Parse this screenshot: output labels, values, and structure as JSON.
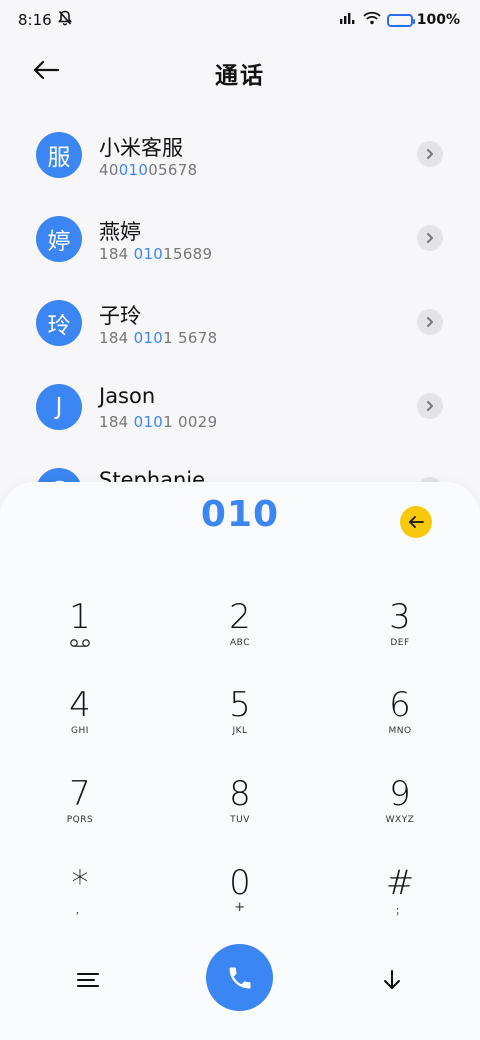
{
  "status_bar": {
    "time": "8:16",
    "battery_label": "100%",
    "battery_level": 1.0,
    "icons": [
      "bell-off-icon",
      "signal-icon",
      "wifi-icon",
      "battery-icon"
    ]
  },
  "header": {
    "title": "通话",
    "back_icon": "arrow-left-icon"
  },
  "contacts": [
    {
      "avatar": "服",
      "name": "小米客服",
      "num_pre": "40",
      "num_hl": "010",
      "num_post": "05678"
    },
    {
      "avatar": "婷",
      "name": "燕婷",
      "num_pre": "184 ",
      "num_hl": "010",
      "num_post": "15689"
    },
    {
      "avatar": "玲",
      "name": "子玲",
      "num_pre": "184 ",
      "num_hl": "010",
      "num_post": "1 5678"
    },
    {
      "avatar": "J",
      "name": "Jason",
      "num_pre": "184 ",
      "num_hl": "010",
      "num_post": "1 0029"
    },
    {
      "avatar": "S",
      "name": "Stephanie",
      "num_pre": "",
      "num_hl": "",
      "num_post": ""
    }
  ],
  "dialpad": {
    "input": "010",
    "delete_icon": "backspace-arrow-icon",
    "keys": [
      {
        "digit": "1",
        "letters": "voicemail-icon"
      },
      {
        "digit": "2",
        "letters": "ABC"
      },
      {
        "digit": "3",
        "letters": "DEF"
      },
      {
        "digit": "4",
        "letters": "GHI"
      },
      {
        "digit": "5",
        "letters": "JKL"
      },
      {
        "digit": "6",
        "letters": "MNO"
      },
      {
        "digit": "7",
        "letters": "PQRS"
      },
      {
        "digit": "8",
        "letters": "TUV"
      },
      {
        "digit": "9",
        "letters": "WXYZ"
      },
      {
        "digit": "*",
        "letters": "，"
      },
      {
        "digit": "0",
        "letters": "+"
      },
      {
        "digit": "#",
        "letters": "；"
      }
    ]
  },
  "bottom": {
    "menu_icon": "menu-icon",
    "call_icon": "phone-icon",
    "collapse_icon": "arrow-down-icon"
  },
  "colors": {
    "accent": "#3b86f2",
    "delete_button": "#f8c80c"
  }
}
